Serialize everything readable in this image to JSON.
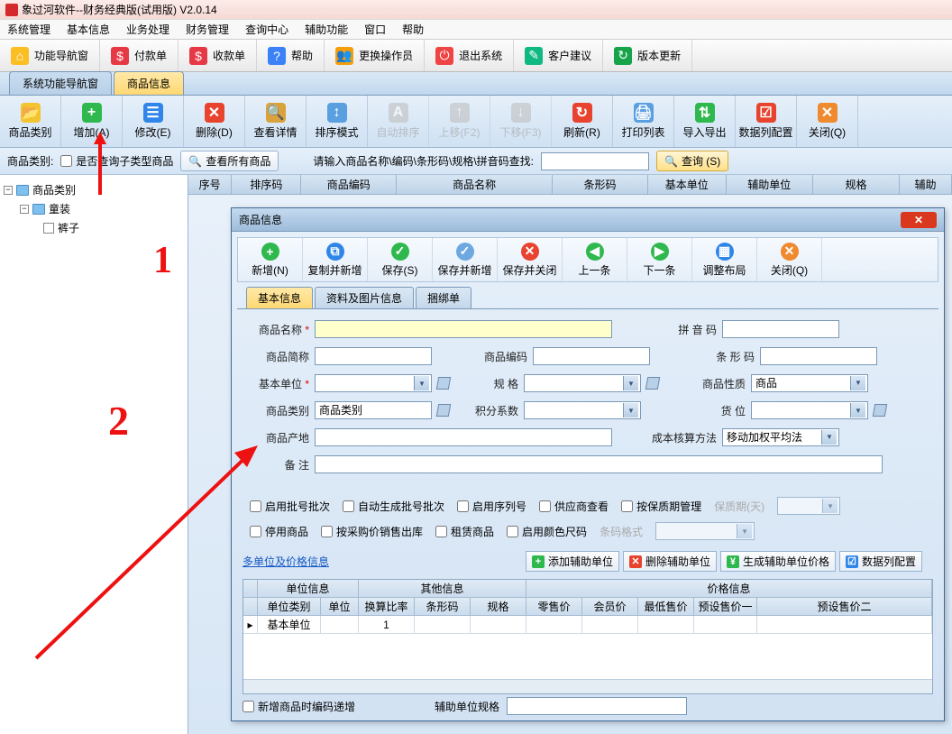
{
  "title": "象过河软件--财务经典版(试用版) V2.0.14",
  "menubar": [
    "系统管理",
    "基本信息",
    "业务处理",
    "财务管理",
    "查询中心",
    "辅助功能",
    "窗口",
    "帮助"
  ],
  "maintb": [
    {
      "label": "功能导航窗",
      "iconBg": "#fbbf24",
      "glyph": "⌂"
    },
    {
      "label": "付款单",
      "iconBg": "#e63946",
      "glyph": "$"
    },
    {
      "label": "收款单",
      "iconBg": "#e63946",
      "glyph": "$"
    },
    {
      "label": "帮助",
      "iconBg": "#3b82f6",
      "glyph": "?"
    },
    {
      "label": "更换操作员",
      "iconBg": "#f59e0b",
      "glyph": "👥"
    },
    {
      "label": "退出系统",
      "iconBg": "#ef4444",
      "glyph": "⏻"
    },
    {
      "label": "客户建议",
      "iconBg": "#10b981",
      "glyph": "✎"
    },
    {
      "label": "版本更新",
      "iconBg": "#16a34a",
      "glyph": "↻"
    }
  ],
  "tabs": {
    "nav": "系统功能导航窗",
    "active": "商品信息"
  },
  "ribbon": [
    {
      "label": "商品类别",
      "iconBg": "#f4c430",
      "glyph": "📂",
      "disabled": false
    },
    {
      "label": "增加(A)",
      "iconBg": "#2fb84d",
      "glyph": "+",
      "disabled": false
    },
    {
      "label": "修改(E)",
      "iconBg": "#2f86e8",
      "glyph": "☰",
      "disabled": false
    },
    {
      "label": "删除(D)",
      "iconBg": "#e8432f",
      "glyph": "✕",
      "disabled": false
    },
    {
      "label": "查看详情",
      "iconBg": "#d9a23a",
      "glyph": "🔍",
      "disabled": false
    },
    {
      "label": "排序模式",
      "iconBg": "#5aa0e0",
      "glyph": "↕",
      "disabled": false
    },
    {
      "label": "自动排序",
      "iconBg": "#bbb",
      "glyph": "A",
      "disabled": true
    },
    {
      "label": "上移(F2)",
      "iconBg": "#bbb",
      "glyph": "↑",
      "disabled": true
    },
    {
      "label": "下移(F3)",
      "iconBg": "#bbb",
      "glyph": "↓",
      "disabled": true
    },
    {
      "label": "刷新(R)",
      "iconBg": "#e8432f",
      "glyph": "↻",
      "disabled": false
    },
    {
      "label": "打印列表",
      "iconBg": "#5aa0e0",
      "glyph": "🖨",
      "disabled": false
    },
    {
      "label": "导入导出",
      "iconBg": "#2fb84d",
      "glyph": "⇅",
      "disabled": false
    },
    {
      "label": "数据列配置",
      "iconBg": "#e8432f",
      "glyph": "☑",
      "disabled": false
    },
    {
      "label": "关闭(Q)",
      "iconBg": "#ef8a2f",
      "glyph": "✕",
      "disabled": false
    }
  ],
  "filter": {
    "lbl_category": "商品类别:",
    "chk_subcat": "是否查询子类型商品",
    "btn_viewall": "查看所有商品",
    "prompt": "请输入商品名称\\编码\\条形码\\规格\\拼音码查找:",
    "btn_search": "查询 (S)"
  },
  "tree": {
    "root": "商品类别",
    "c1": "童装",
    "c2": "裤子"
  },
  "grid_cols": [
    "序号",
    "排序码",
    "商品编码",
    "商品名称",
    "条形码",
    "基本单位",
    "辅助单位",
    "规格",
    "辅助"
  ],
  "modal": {
    "title": "商品信息",
    "toolbar": [
      {
        "label": "新增(N)",
        "bg": "#2fb84d",
        "glyph": "+"
      },
      {
        "label": "复制并新增",
        "bg": "#2f86e8",
        "glyph": "⧉"
      },
      {
        "label": "保存(S)",
        "bg": "#2fb84d",
        "glyph": "✓"
      },
      {
        "label": "保存并新增",
        "bg": "#6ea8e0",
        "glyph": "✓"
      },
      {
        "label": "保存并关闭",
        "bg": "#e8432f",
        "glyph": "✕"
      },
      {
        "label": "上一条",
        "bg": "#2fb84d",
        "glyph": "◀"
      },
      {
        "label": "下一条",
        "bg": "#2fb84d",
        "glyph": "▶"
      },
      {
        "label": "调整布局",
        "bg": "#2f86e8",
        "glyph": "▦"
      },
      {
        "label": "关闭(Q)",
        "bg": "#ef8a2f",
        "glyph": "✕"
      }
    ],
    "tabs": [
      "基本信息",
      "资料及图片信息",
      "捆绑单"
    ],
    "labels": {
      "name": "商品名称",
      "pinyin": "拼 音 码",
      "short": "商品简称",
      "code": "商品编码",
      "barcode": "条 形 码",
      "unit": "基本单位",
      "spec": "规 格",
      "nature": "商品性质",
      "nature_val": "商品",
      "category": "商品类别",
      "category_val": "商品类别",
      "points": "积分系数",
      "slot": "货 位",
      "origin": "商品产地",
      "cost": "成本核算方法",
      "cost_val": "移动加权平均法",
      "remark": "备 注"
    },
    "checks1": [
      "启用批号批次",
      "自动生成批号批次",
      "启用序列号",
      "供应商查看",
      "按保质期管理"
    ],
    "warranty": "保质期(天)",
    "checks2": [
      "停用商品",
      "按采购价销售出库",
      "租赁商品",
      "启用颜色尺码"
    ],
    "barcode_fmt": "条码格式",
    "multi_link": "多单位及价格信息",
    "sub_btns": [
      {
        "label": "添加辅助单位",
        "bg": "#2fb84d",
        "glyph": "+"
      },
      {
        "label": "删除辅助单位",
        "bg": "#e8432f",
        "glyph": "✕"
      },
      {
        "label": "生成辅助单位价格",
        "bg": "#2fb84d",
        "glyph": "¥"
      },
      {
        "label": "数据列配置",
        "bg": "#2f86e8",
        "glyph": "☑"
      }
    ],
    "grid_groups": [
      "单位信息",
      "其他信息",
      "价格信息"
    ],
    "grid_cols": [
      "单位类别",
      "单位",
      "换算比率",
      "条形码",
      "规格",
      "零售价",
      "会员价",
      "最低售价",
      "预设售价一",
      "预设售价二"
    ],
    "grid_row": {
      "kind": "基本单位",
      "ratio": "1"
    },
    "footer_chk": "新增商品时编码递增",
    "footer_lbl": "辅助单位规格"
  },
  "annot": {
    "n1": "1",
    "n2": "2"
  }
}
